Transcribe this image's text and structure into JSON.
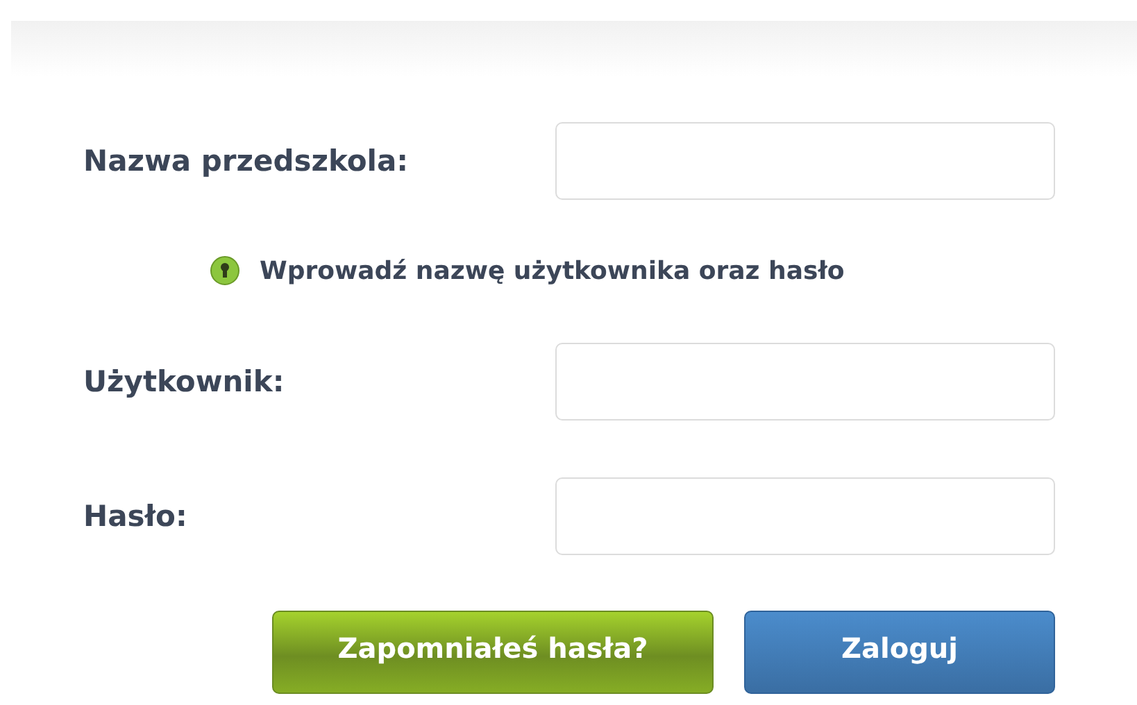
{
  "fields": [
    {
      "label": "Nazwa przedszkola:"
    },
    {
      "label": "Użytkownik:"
    },
    {
      "label": "Hasło:"
    }
  ],
  "info": "Wprowadź nazwę użytkownika oraz hasło",
  "buttons": [
    {
      "label": "Zapomniałeś hasła?",
      "kind": "secondary"
    },
    {
      "label": "Zaloguj",
      "kind": "primary"
    }
  ]
}
